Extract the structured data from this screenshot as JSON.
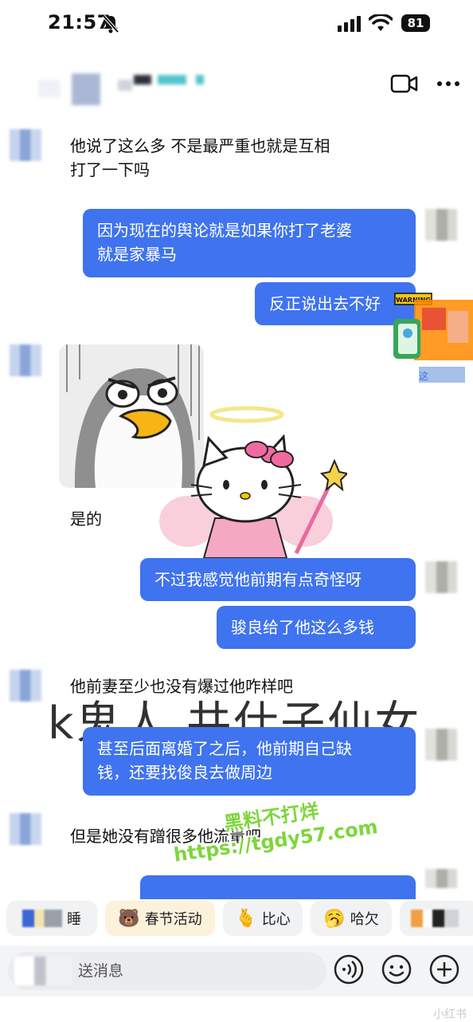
{
  "status_bar": {
    "time": "21:57",
    "battery": "81"
  },
  "header": {
    "icons": [
      "video-call-icon",
      "more-icon"
    ]
  },
  "messages": [
    {
      "side": "incoming",
      "text": "他说了这么多 不是最严重也就是互相\n打了一下吗"
    },
    {
      "side": "outgoing",
      "text": "因为现在的舆论就是如果你打了老婆\n就是家暴马"
    },
    {
      "side": "outgoing",
      "text": "反正说出去不好"
    },
    {
      "side": "incoming",
      "text": "是的"
    },
    {
      "side": "outgoing",
      "text": "不过我感觉他前期有点奇怪呀"
    },
    {
      "side": "outgoing",
      "text": "骏良给了他这么多钱"
    },
    {
      "side": "incoming",
      "text": "他前妻至少也没有爆过他咋样吧"
    },
    {
      "side": "outgoing",
      "text": "甚至后面离婚了之后，他前期自己缺\n钱，还要找俊良去做周边"
    },
    {
      "side": "incoming",
      "text": "但是她没有蹭很多他流量吧"
    }
  ],
  "stickers": {
    "warning_text": "WARNING"
  },
  "watermarks": {
    "overlay": "k鬼人 共仕子仙女",
    "site_line1": "黑料不打烊",
    "site_line2": "https://tgdy57.com"
  },
  "quick_replies": [
    {
      "label": "睡",
      "icon": ""
    },
    {
      "label": "春节活动",
      "icon": "bear-icon"
    },
    {
      "label": "比心",
      "icon": "finger-heart-icon"
    },
    {
      "label": "哈欠",
      "icon": "yawn-icon"
    }
  ],
  "input": {
    "placeholder": "送消息"
  },
  "footer": {
    "mark": "小红书"
  },
  "colors": {
    "bubble_blue": "#3f73ef",
    "chip_bg": "#f1f2f4",
    "watermark_green": "#7dd63b"
  }
}
